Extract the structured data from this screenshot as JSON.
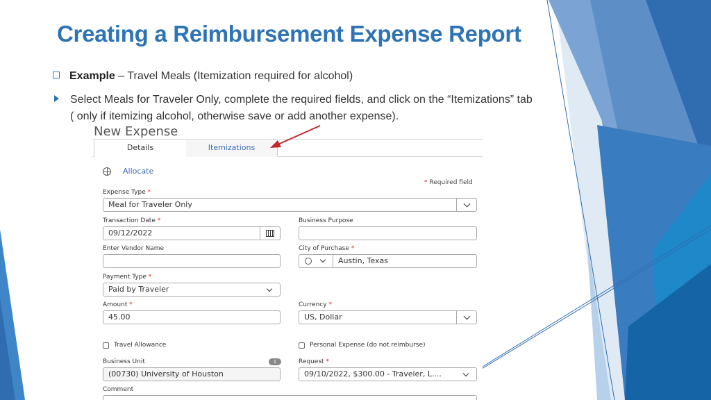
{
  "slide": {
    "title": "Creating a Reimbursement Expense Report",
    "bullet1_bold": "Example",
    "bullet1_rest": " – Travel Meals (Itemization required for alcohol)",
    "bullet2": "Select Meals for Traveler Only, complete the required fields, and click on the “Itemizations” tab ( only if itemizing alcohol, otherwise save or add another expense)."
  },
  "form": {
    "title": "New Expense",
    "tabs": [
      {
        "label": "Details"
      },
      {
        "label": "Itemizations"
      }
    ],
    "allocate": "Allocate",
    "required_marker": "*",
    "required_note": "Required field",
    "expense_type": {
      "label": "Expense Type",
      "value": "Meal for Traveler Only"
    },
    "transaction_date": {
      "label": "Transaction Date",
      "value": "09/12/2022"
    },
    "business_purpose": {
      "label": "Business Purpose",
      "value": ""
    },
    "vendor_name": {
      "label": "Enter Vendor Name",
      "value": ""
    },
    "city": {
      "label": "City of Purchase",
      "value": "Austin, Texas"
    },
    "payment_type": {
      "label": "Payment Type",
      "value": "Paid by Traveler"
    },
    "amount": {
      "label": "Amount",
      "value": "45.00"
    },
    "currency": {
      "label": "Currency",
      "value": "US, Dollar"
    },
    "travel_allowance": {
      "label": "Travel Allowance",
      "checked": false
    },
    "personal_expense": {
      "label": "Personal Expense (do not reimburse)",
      "checked": false
    },
    "business_unit": {
      "label": "Business Unit",
      "badge": "1",
      "value": "(00730) University of Houston"
    },
    "request": {
      "label": "Request",
      "value": "09/10/2022, $300.00 - Traveler, L...."
    },
    "comment": {
      "label": "Comment"
    }
  },
  "colors": {
    "title": "#2e74b5",
    "link": "#3b6db3",
    "required": "#dd2222",
    "arrow": "#c0282d"
  }
}
